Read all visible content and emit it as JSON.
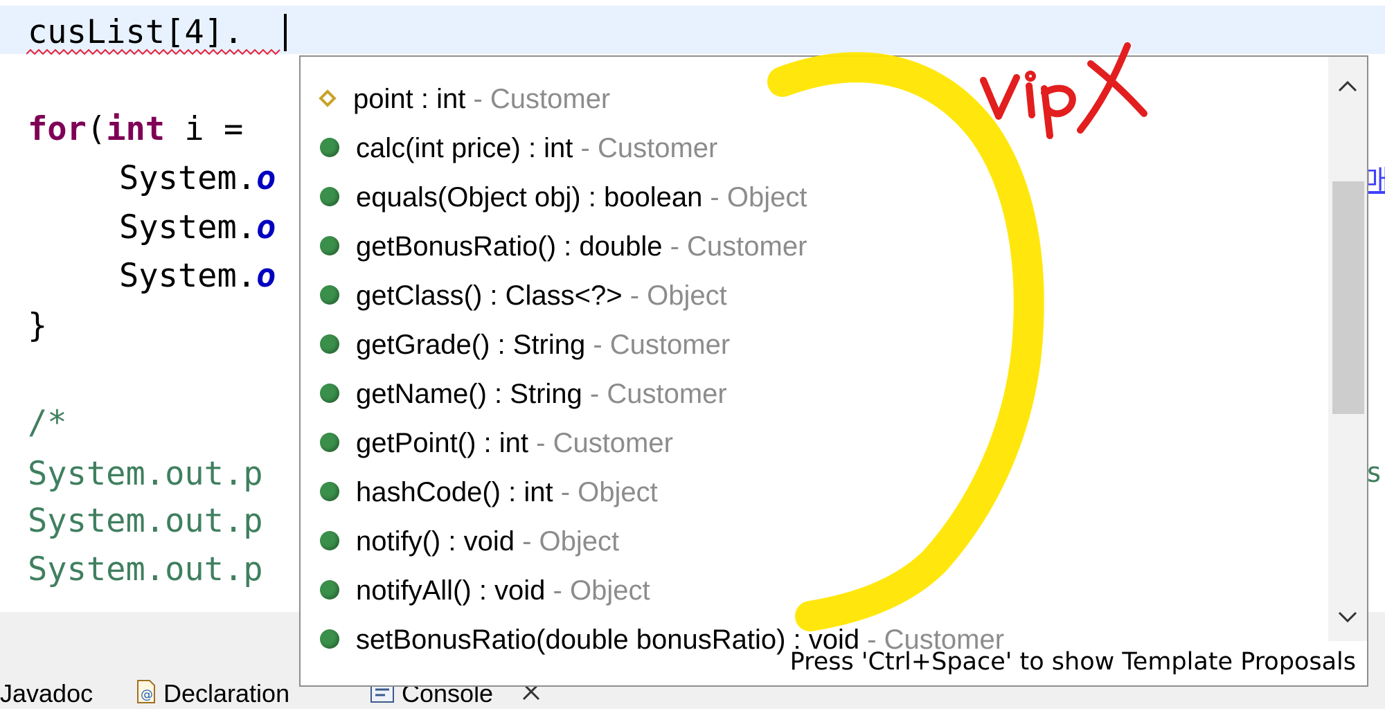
{
  "editor": {
    "lines": [
      "cusList[4].",
      "",
      "for(int i = ",
      "    System.o",
      "    System.o",
      "    System.o",
      "}",
      "",
      "/*",
      "System.out.p",
      "System.out.p",
      "System.out.p"
    ],
    "edge_right_1": "매",
    "edge_right_2": "s"
  },
  "completion_popup": {
    "proposals": [
      {
        "icon": "field-icon",
        "signature": "point : int",
        "sep": " - ",
        "owner": "Customer"
      },
      {
        "icon": "method-icon",
        "signature": "calc(int price) : int",
        "sep": " - ",
        "owner": "Customer"
      },
      {
        "icon": "method-icon",
        "signature": "equals(Object obj) : boolean",
        "sep": " - ",
        "owner": "Object"
      },
      {
        "icon": "method-icon",
        "signature": "getBonusRatio() : double",
        "sep": " - ",
        "owner": "Customer"
      },
      {
        "icon": "method-icon",
        "signature": "getClass() : Class<?>",
        "sep": " - ",
        "owner": "Object"
      },
      {
        "icon": "method-icon",
        "signature": "getGrade() : String",
        "sep": " - ",
        "owner": "Customer"
      },
      {
        "icon": "method-icon",
        "signature": "getName() : String",
        "sep": " - ",
        "owner": "Customer"
      },
      {
        "icon": "method-icon",
        "signature": "getPoint() : int",
        "sep": " - ",
        "owner": "Customer"
      },
      {
        "icon": "method-icon",
        "signature": "hashCode() : int",
        "sep": " - ",
        "owner": "Object"
      },
      {
        "icon": "method-icon",
        "signature": "notify() : void",
        "sep": " - ",
        "owner": "Object"
      },
      {
        "icon": "method-icon",
        "signature": "notifyAll() : void",
        "sep": " - ",
        "owner": "Object"
      },
      {
        "icon": "method-icon",
        "signature": "setBonusRatio(double bonusRatio) : void",
        "sep": " - ",
        "owner": "Customer"
      }
    ],
    "hint": "Press 'Ctrl+Space' to show Template Proposals"
  },
  "view_tabs": [
    {
      "label": "Javadoc",
      "icon": "javadoc-icon"
    },
    {
      "label": "Declaration",
      "icon": "declaration-icon"
    },
    {
      "label": "Console",
      "icon": "console-icon"
    }
  ],
  "annotation": {
    "text": "vip X",
    "colors": {
      "ink": "#e21e1e",
      "highlight": "#ffe600"
    }
  },
  "colors": {
    "keyword": "#7f0055",
    "comment": "#3f7f5f",
    "current_line": "#e8f2fe",
    "method_icon": "#3a8f4a",
    "owner_text": "#8c8c8c"
  }
}
